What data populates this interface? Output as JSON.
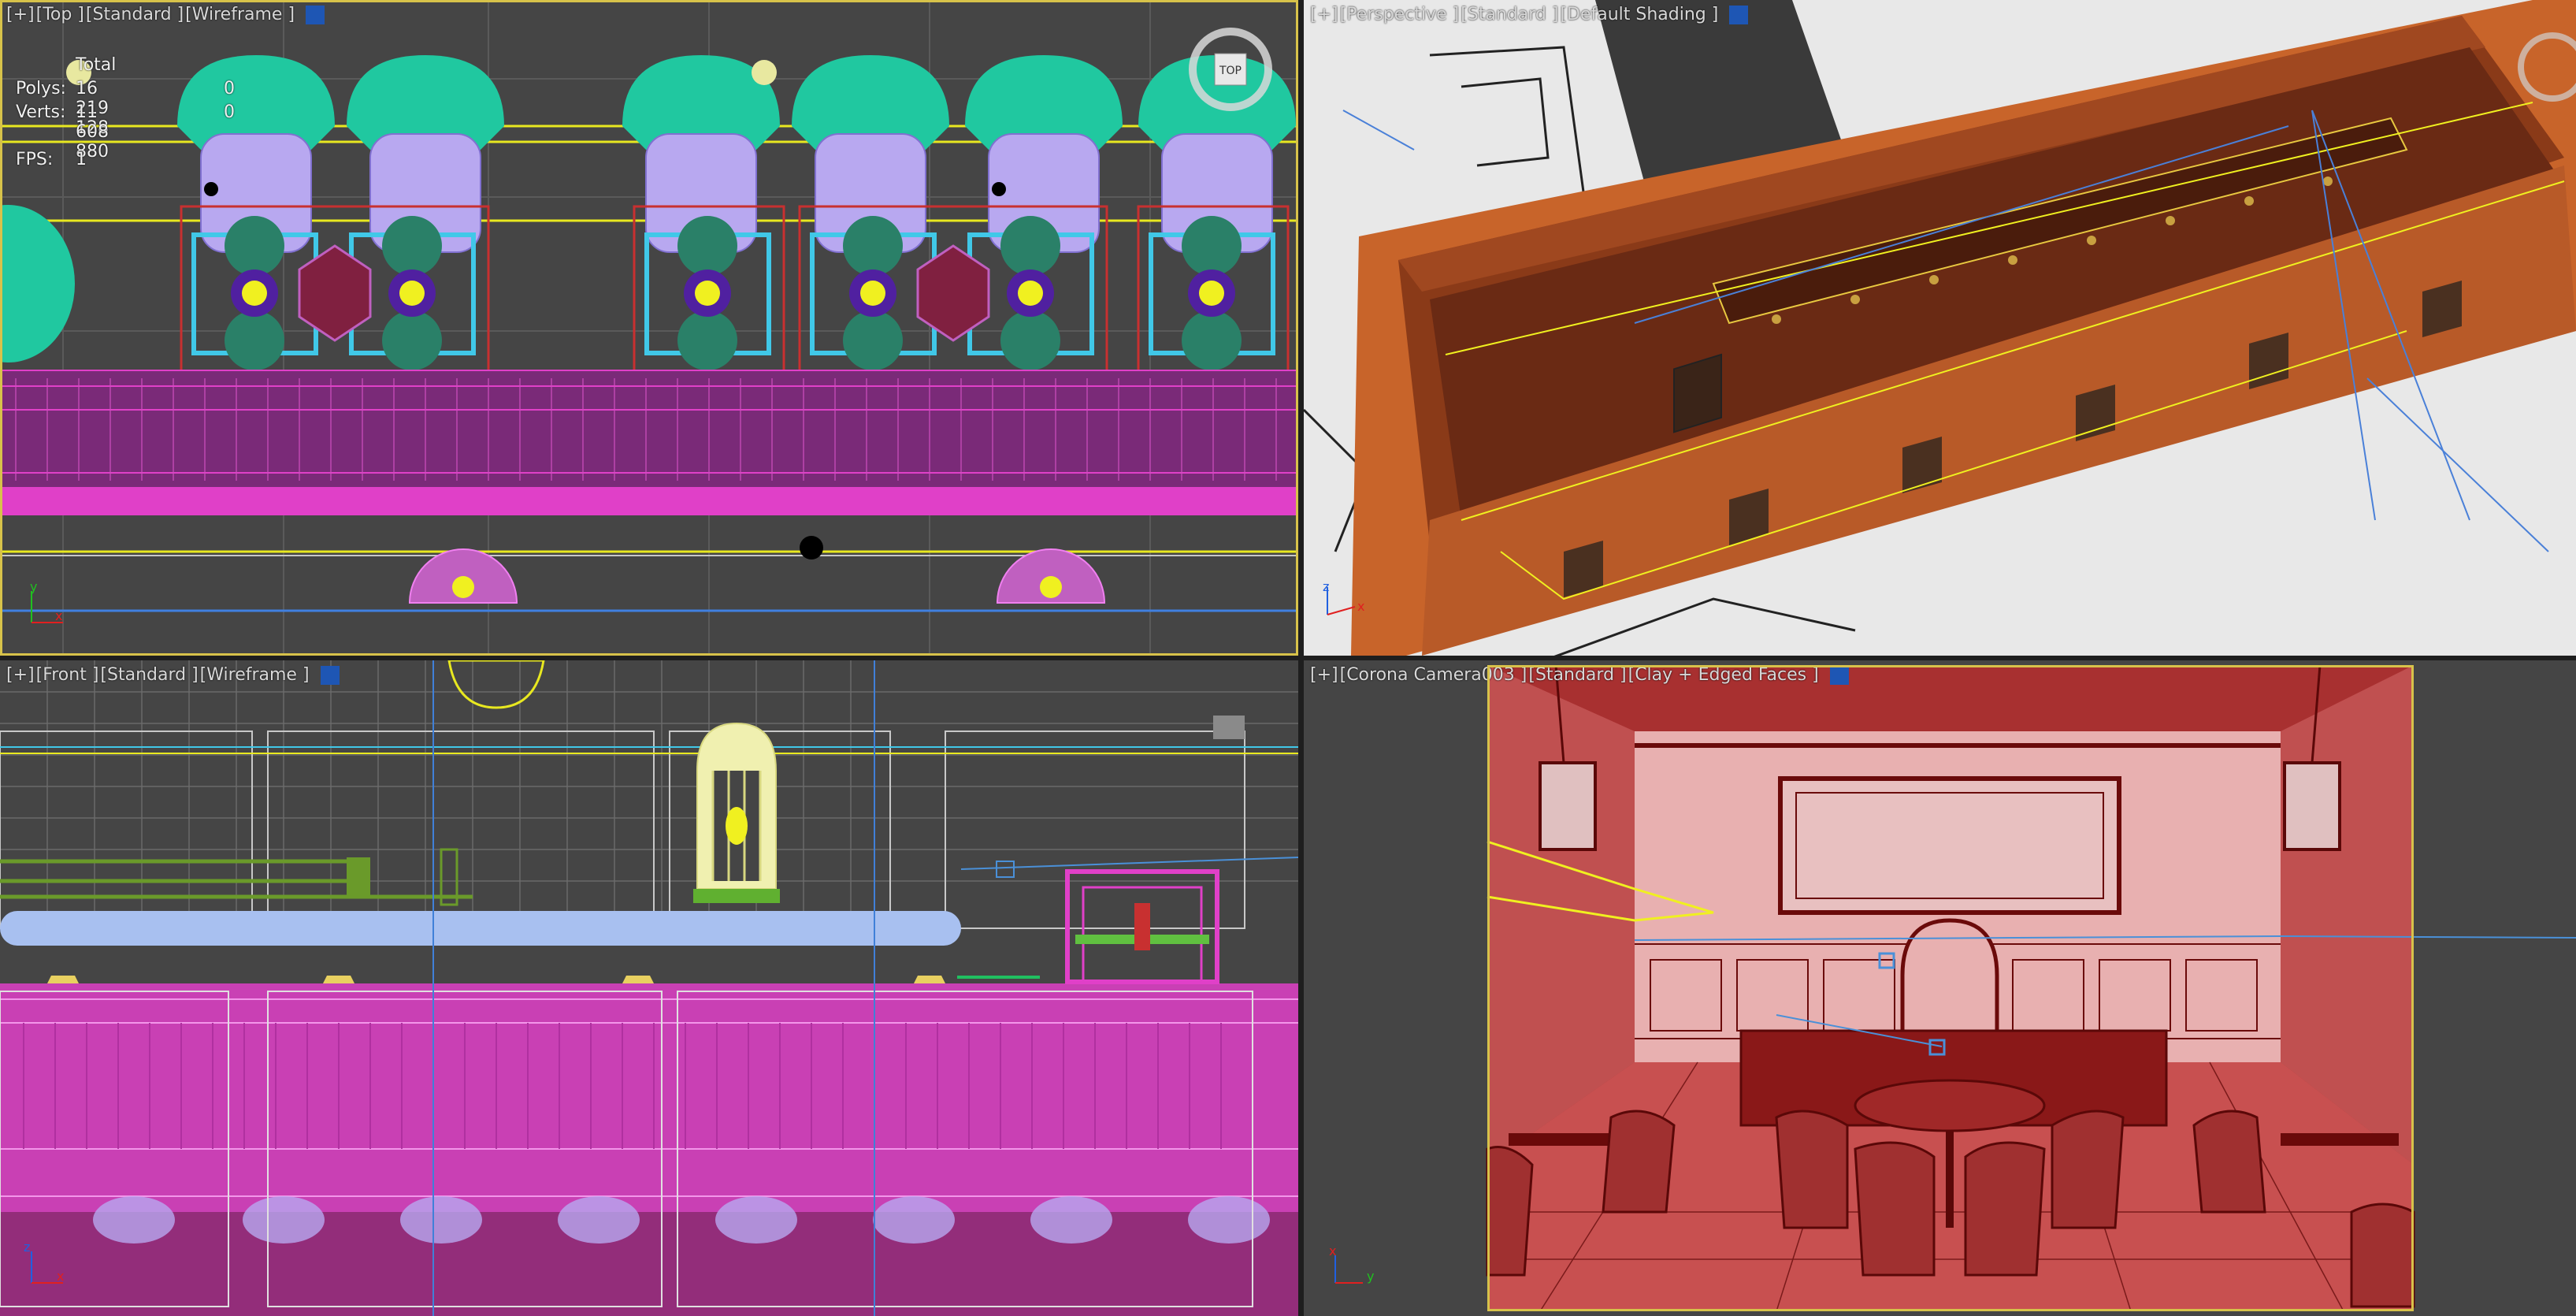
{
  "viewports": {
    "top": {
      "label": [
        "[+]",
        "[Top ]",
        "[Standard ]",
        "[Wireframe ]"
      ],
      "stats": {
        "header": "Total",
        "polys_label": "Polys:",
        "polys_total": "16 219 128",
        "polys_sel": "0",
        "verts_label": "Verts:",
        "verts_total": "11 608 880",
        "verts_sel": "0",
        "fps_label": "FPS:",
        "fps_value": "1"
      },
      "viewcube": "TOP",
      "axis": {
        "x": "x",
        "y": "y"
      }
    },
    "perspective": {
      "label": [
        "[+]",
        "[Perspective ]",
        "[Standard ]",
        "[Default Shading ]"
      ],
      "axis": {
        "x": "x",
        "y": "y",
        "z": "z"
      }
    },
    "front": {
      "label": [
        "[+]",
        "[Front ]",
        "[Standard ]",
        "[Wireframe ]"
      ],
      "axis": {
        "x": "x",
        "z": "z"
      }
    },
    "camera": {
      "label": [
        "[+]",
        "[Corona Camera003 ]",
        "[Standard ]",
        "[Clay + Edged Faces ]"
      ],
      "axis": {
        "x": "x",
        "y": "y"
      }
    }
  },
  "colors": {
    "viewport_bg": "#454545",
    "wire_pink": "#e040c8",
    "wire_teal": "#20c8a0",
    "wire_lavender": "#b8a8f0",
    "wire_cyan": "#40c8e8",
    "wire_yellow": "#f0f020",
    "clay_orange": "#c8642a",
    "camera_red": "#b83a3a",
    "active_border": "#d7c24a",
    "label_square": "#1e56b4"
  }
}
